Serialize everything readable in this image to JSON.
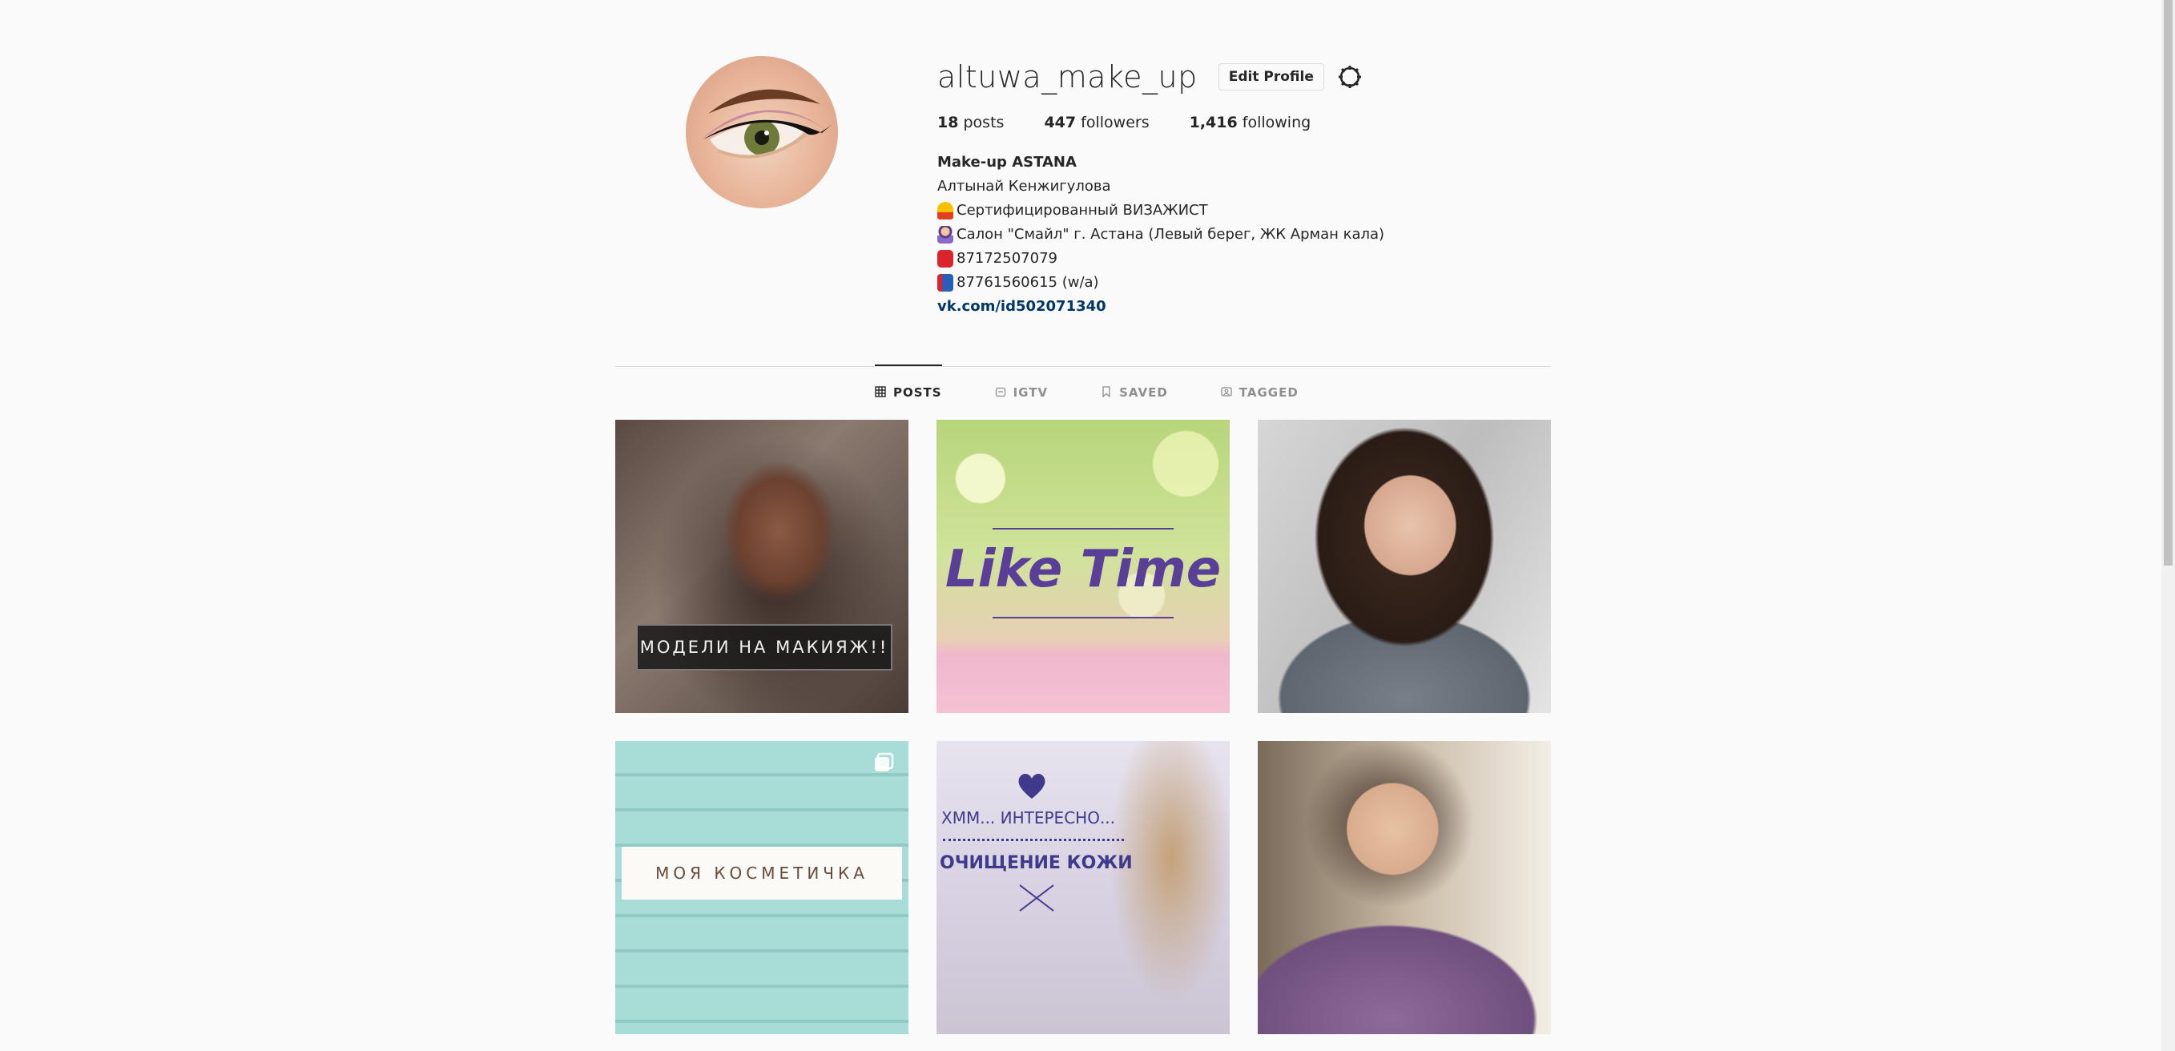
{
  "profile": {
    "username": "altuwa_make_up",
    "edit_label": "Edit Profile",
    "stats": {
      "posts_count": "18",
      "posts_label": "posts",
      "followers_count": "447",
      "followers_label": "followers",
      "following_count": "1,416",
      "following_label": "following"
    },
    "bio": {
      "name": "Make-up ASTANA",
      "line1": "Алтынай Кенжигулова",
      "line2": "Сертифицированный ВИЗАЖИСТ",
      "line3": " Салон \"Смайл\" г. Астана (Левый берег, ЖК Арман кала)",
      "line4": "87172507079",
      "line5": " 87761560615 (w/a)",
      "link": "vk.com/id502071340"
    }
  },
  "tabs": [
    {
      "label": "POSTS",
      "icon": "grid-icon",
      "active": true
    },
    {
      "label": "IGTV",
      "icon": "igtv-icon",
      "active": false
    },
    {
      "label": "SAVED",
      "icon": "bookmark-icon",
      "active": false
    },
    {
      "label": "TAGGED",
      "icon": "tag-icon",
      "active": false
    }
  ],
  "posts": {
    "p1_text": "МОДЕЛИ НА МАКИЯЖ!!",
    "p2_text": "Like Time",
    "p4_text": "МОЯ КОСМЕТИЧКА",
    "p5_text1": "ХММ... ИНТЕРЕСНО...",
    "p5_text2": "ОЧИЩЕНИЕ КОЖИ"
  },
  "colors": {
    "link": "#003569",
    "border": "#dbdbdb",
    "text": "#262626",
    "muted": "#8e8e8e"
  }
}
